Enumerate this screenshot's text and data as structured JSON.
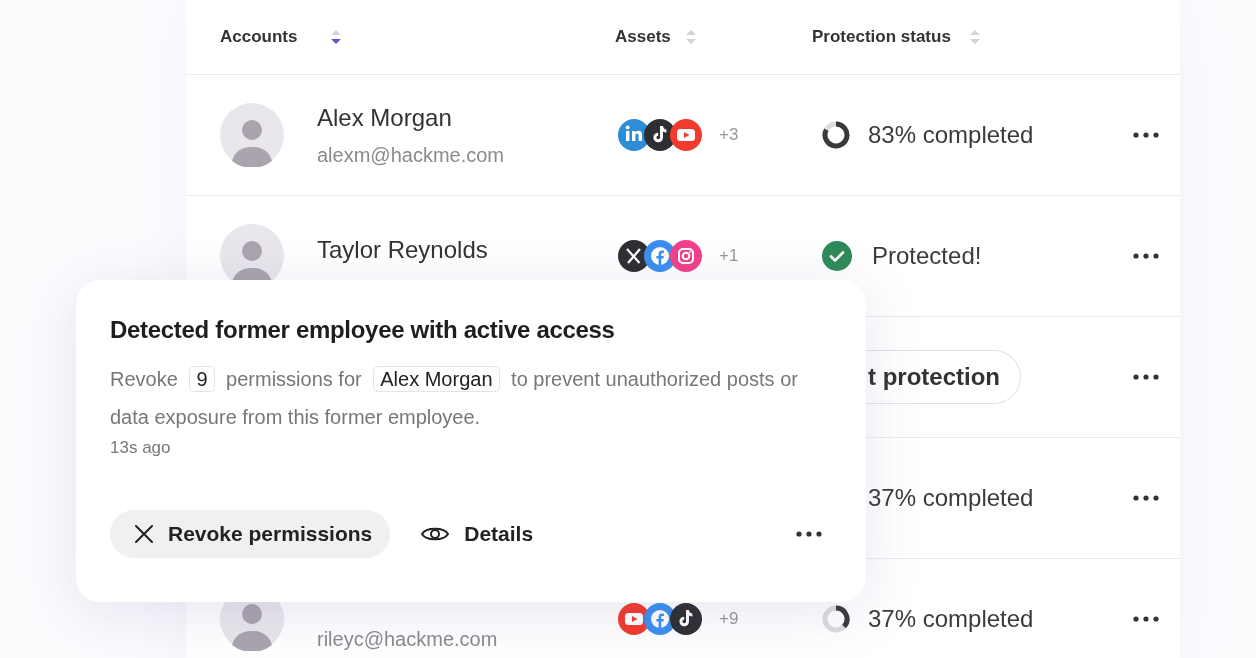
{
  "table": {
    "columns": [
      {
        "label": "Accounts",
        "sorted": true
      },
      {
        "label": "Assets",
        "sorted": false
      },
      {
        "label": "Protection status",
        "sorted": false
      }
    ],
    "rows": [
      {
        "account": {
          "name": "Alex Morgan",
          "email": "alexm@hackme.com"
        },
        "assets": [
          {
            "kind": "linkedin"
          },
          {
            "kind": "tiktok"
          },
          {
            "kind": "youtube"
          }
        ],
        "more_assets": "+3",
        "status": {
          "kind": "progress",
          "text": "83% completed"
        }
      },
      {
        "account": {
          "name": "Taylor Reynolds"
        },
        "assets": [
          {
            "kind": "x"
          },
          {
            "kind": "facebook"
          },
          {
            "kind": "instagram"
          }
        ],
        "more_assets": "+1",
        "status": {
          "kind": "protected",
          "text": "Protected!"
        }
      },
      {
        "status": {
          "kind": "button",
          "text": "t protection"
        }
      },
      {
        "status": {
          "kind": "text",
          "text": "37% completed"
        }
      },
      {
        "account": {
          "email": "rileyc@hackme.com"
        },
        "assets": [
          {
            "kind": "youtube"
          },
          {
            "kind": "facebook"
          },
          {
            "kind": "tiktok"
          }
        ],
        "more_assets": "+9",
        "status": {
          "kind": "progress",
          "text": "37% completed"
        }
      }
    ]
  },
  "alert": {
    "title": "Detected former employee with active access",
    "message": [
      {
        "kind": "text",
        "text": "Revoke"
      },
      {
        "kind": "chip",
        "text": "9"
      },
      {
        "kind": "text",
        "text": "permissions for"
      },
      {
        "kind": "chip",
        "text": "Alex Morgan"
      },
      {
        "kind": "text",
        "text": "to prevent unauthorized posts or data exposure from this former employee."
      }
    ],
    "time": "13s ago",
    "actions": [
      {
        "kind": "primary",
        "label": "Revoke permissions"
      },
      {
        "kind": "link",
        "label": "Details"
      }
    ]
  }
}
